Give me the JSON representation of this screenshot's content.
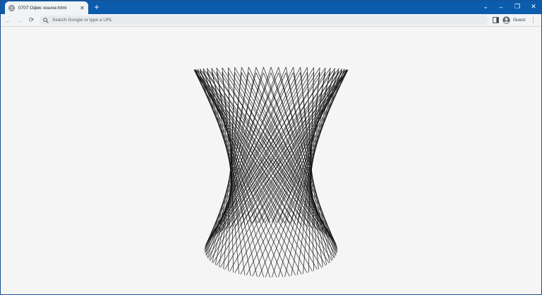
{
  "browser": {
    "tab": {
      "title": "0707 Офис кошче.html",
      "favicon": "globe-icon"
    },
    "new_tab": "+",
    "window_controls": {
      "dropdown": "⌄",
      "minimize": "–",
      "restore": "❐",
      "close": "✕"
    },
    "nav": {
      "back": "←",
      "forward": "→",
      "reload": "⟳"
    },
    "omnibox": {
      "placeholder": "Search Google or type a URL"
    },
    "profile": {
      "label": "Guest"
    },
    "menu": "⋮"
  },
  "page": {
    "background": "#f5f5f5",
    "line_color": "#111111",
    "line_count": 64,
    "description": ""
  }
}
